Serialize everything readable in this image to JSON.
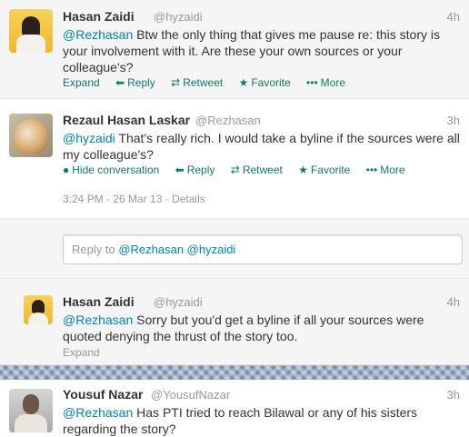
{
  "tweets": [
    {
      "name": "Hasan Zaidi",
      "handle": "@hyzaidi",
      "time": "4h",
      "mention": "@Rezhasan",
      "text": " Btw the only thing that gives me pause re: this story is your involvement with it. Are these your own sources or your colleague's?",
      "actions": {
        "expand": "Expand",
        "reply": "Reply",
        "retweet": "Retweet",
        "favorite": "Favorite",
        "more": "More"
      }
    },
    {
      "name": "Rezaul Hasan Laskar",
      "handle": "@Rezhasan",
      "time": "3h",
      "mention": "@hyzaidi",
      "text": " That's really rich. I would take a byline if the sources were all my colleague's?",
      "actions": {
        "hide": "Hide conversation",
        "reply": "Reply",
        "retweet": "Retweet",
        "favorite": "Favorite",
        "more": "More"
      },
      "timestamp": "3:24 PM - 26 Mar 13",
      "details": "Details"
    },
    {
      "name": "Hasan Zaidi",
      "handle": "@hyzaidi",
      "time": "4h",
      "mention": "@Rezhasan",
      "text": " Sorry but you'd get a byline if all your sources were quoted denying the thrust of the story too.",
      "actions": {
        "expand": "Expand"
      }
    },
    {
      "name": "Yousuf Nazar",
      "handle": "@YousufNazar",
      "time": "3h",
      "mention": "@Rezhasan",
      "text": " Has PTI tried to reach Bilawal or any of his sisters regarding the story?"
    }
  ],
  "reply": {
    "prefix": "Reply to ",
    "mentions": "@Rezhasan @hyzaidi"
  },
  "icons": {
    "reply": "reply-arrow-icon",
    "retweet": "retweet-icon",
    "favorite": "star-icon",
    "more": "more-dots-icon",
    "hide": "speech-bubble-icon"
  },
  "colors": {
    "action": "#0e7c69",
    "mention": "#0084b4",
    "muted": "#999999"
  }
}
